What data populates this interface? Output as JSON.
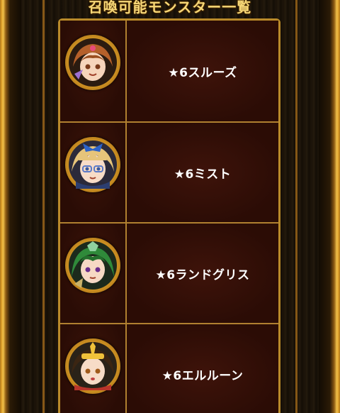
{
  "title": "召喚可能モンスター一覧",
  "monsters": [
    {
      "name": "★6スルーズ",
      "icon": "sruz-portrait-icon",
      "hair": "#b5602a",
      "accent": "#9b6fd1"
    },
    {
      "name": "★6ミスト",
      "icon": "mist-portrait-icon",
      "hair": "#e6c47a",
      "accent": "#2c63c8"
    },
    {
      "name": "★6ランドグリス",
      "icon": "randgris-portrait-icon",
      "hair": "#2f8a3a",
      "accent": "#8fd1a0"
    },
    {
      "name": "★6エルルーン",
      "icon": "ellrun-portrait-icon",
      "hair": "#3b2512",
      "accent": "#f0c23a"
    }
  ]
}
